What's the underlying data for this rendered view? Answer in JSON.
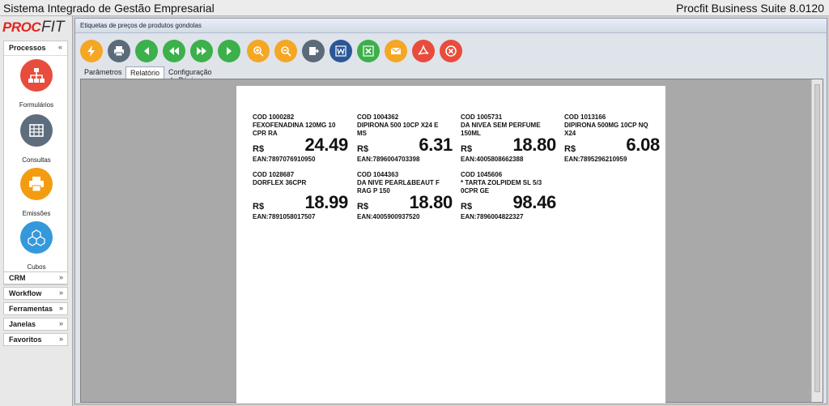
{
  "titlebar": {
    "title": "Sistema Integrado de Gestão Empresarial",
    "product": "Procfit Business Suite 8.0120"
  },
  "logo": {
    "part1": "PROC",
    "part2": "FIT"
  },
  "sidebar": {
    "processos": {
      "label": "Processos",
      "chevron": "«",
      "items": [
        {
          "label": "Formulários",
          "icon": "org-chart-icon",
          "color": "#e74c3c"
        },
        {
          "label": "Consultas",
          "icon": "table-icon",
          "color": "#5d6d7e"
        },
        {
          "label": "Emissões",
          "icon": "printer-icon",
          "color": "#f39c12"
        },
        {
          "label": "Cubos",
          "icon": "cubes-icon",
          "color": "#3498db"
        }
      ]
    },
    "sections": [
      {
        "label": "CRM",
        "chevron": "»"
      },
      {
        "label": "Workflow",
        "chevron": "»"
      },
      {
        "label": "Ferramentas",
        "chevron": "»"
      },
      {
        "label": "Janelas",
        "chevron": "»"
      },
      {
        "label": "Favoritos",
        "chevron": "»"
      }
    ]
  },
  "window": {
    "title": "Etiquetas de preços de produtos gondolas"
  },
  "toolbar": [
    {
      "name": "lightning-icon",
      "color": "#f5a623"
    },
    {
      "name": "printer-icon",
      "color": "#5b6b7a"
    },
    {
      "name": "first-icon",
      "color": "#3cb04a"
    },
    {
      "name": "rewind-icon",
      "color": "#3cb04a"
    },
    {
      "name": "forward-icon",
      "color": "#3cb04a"
    },
    {
      "name": "play-icon",
      "color": "#3cb04a"
    },
    {
      "name": "zoom-in-icon",
      "color": "#f5a623"
    },
    {
      "name": "zoom-out-icon",
      "color": "#f5a623"
    },
    {
      "name": "export-icon",
      "color": "#5b6b7a"
    },
    {
      "name": "word-icon",
      "color": "#2b5797"
    },
    {
      "name": "excel-icon",
      "color": "#3cb04a"
    },
    {
      "name": "email-icon",
      "color": "#f5a623"
    },
    {
      "name": "pdf-icon",
      "color": "#e74c3c"
    },
    {
      "name": "close-icon",
      "color": "#e74c3c"
    }
  ],
  "tabs": [
    {
      "label": "Parâmetros",
      "active": false
    },
    {
      "label": "Relatório",
      "active": true
    },
    {
      "label": "Configuração de Páginas",
      "active": false
    }
  ],
  "labels": [
    {
      "cod": "COD    1000282",
      "desc": "FEXOFENADINA 120MG 10 CPR RA",
      "currency": "R$",
      "price": "24.49",
      "ean": "EAN:7897076910950"
    },
    {
      "cod": "COD    1004362",
      "desc": "DIPIRONA 500 10CP X24 E MS",
      "currency": "R$",
      "price": "6.31",
      "ean": "EAN:7896004703398"
    },
    {
      "cod": "COD    1005731",
      "desc": "DA NIVEA SEM PERFUME 150ML",
      "currency": "R$",
      "price": "18.80",
      "ean": "EAN:4005808662388"
    },
    {
      "cod": "COD    1013166",
      "desc": "DIPIRONA 500MG 10CP NQ X24",
      "currency": "R$",
      "price": "6.08",
      "ean": "EAN:7895296210959"
    },
    {
      "cod": "COD    1028687",
      "desc": "DORFLEX 36CPR",
      "currency": "R$",
      "price": "18.99",
      "ean": "EAN:7891058017507"
    },
    {
      "cod": "COD    1044363",
      "desc": "DA NIVE PEARL&BEAUT F RAG P 150",
      "currency": "R$",
      "price": "18.80",
      "ean": "EAN:4005900937520"
    },
    {
      "cod": "COD    1045606",
      "desc": "* TARTA ZOLPIDEM SL 5/3 0CPR GE",
      "currency": "R$",
      "price": "98.46",
      "ean": "EAN:7896004822327"
    }
  ]
}
